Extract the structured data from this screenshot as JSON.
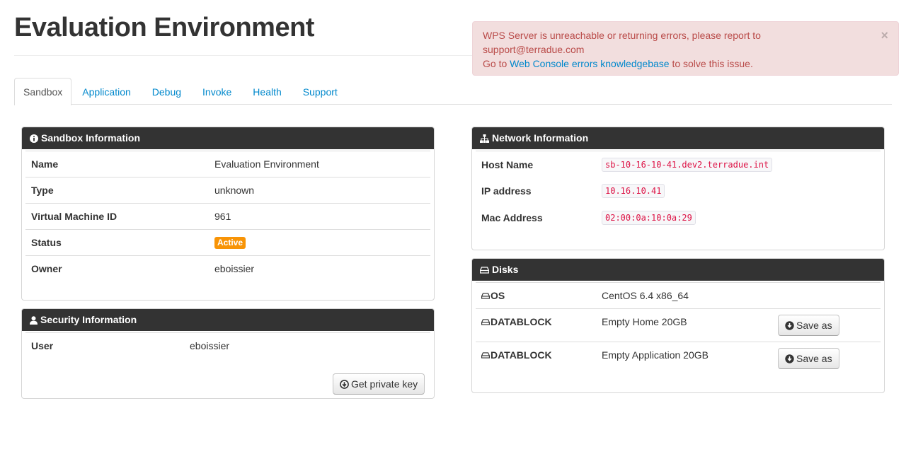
{
  "page": {
    "title": "Evaluation Environment"
  },
  "alert": {
    "line1": "WPS Server is unreachable or returning errors, please report to",
    "line2": "support@terradue.com",
    "go_to": "Go to",
    "link_text": "Web Console errors knowledgebase",
    "suffix": "to solve this issue.",
    "close_symbol": "×"
  },
  "tabs": [
    {
      "label": "Sandbox",
      "active": true
    },
    {
      "label": "Application"
    },
    {
      "label": "Debug"
    },
    {
      "label": "Invoke"
    },
    {
      "label": "Health"
    },
    {
      "label": "Support"
    }
  ],
  "sandbox_info": {
    "title": "Sandbox Information",
    "rows": [
      {
        "label": "Name",
        "value": "Evaluation Environment"
      },
      {
        "label": "Type",
        "value": "unknown"
      },
      {
        "label": "Virtual Machine ID",
        "value": "961"
      },
      {
        "label": "Status",
        "value": "Active"
      },
      {
        "label": "Owner",
        "value": "eboissier"
      }
    ]
  },
  "security_info": {
    "title": "Security Information",
    "user_label": "User",
    "user_value": "eboissier",
    "button_label": "Get private key"
  },
  "network_info": {
    "title": "Network Information",
    "rows": [
      {
        "label": "Host Name",
        "value": "sb-10-16-10-41.dev2.terradue.int"
      },
      {
        "label": "IP address",
        "value": "10.16.10.41"
      },
      {
        "label": "Mac Address",
        "value": "02:00:0a:10:0a:29"
      }
    ]
  },
  "disks": {
    "title": "Disks",
    "rows": [
      {
        "type": "OS",
        "value": "CentOS 6.4 x86_64"
      },
      {
        "type": "DATABLOCK",
        "value": "Empty Home 20GB",
        "button": "Save as"
      },
      {
        "type": "DATABLOCK",
        "value": "Empty Application 20GB",
        "button": "Save as"
      }
    ]
  },
  "colors": {
    "panel_header": "#333333",
    "link": "#0088cc",
    "alert_bg": "#f2dede",
    "alert_text": "#b94a48",
    "status_active": "#f89406",
    "code_text": "#dd1144"
  }
}
